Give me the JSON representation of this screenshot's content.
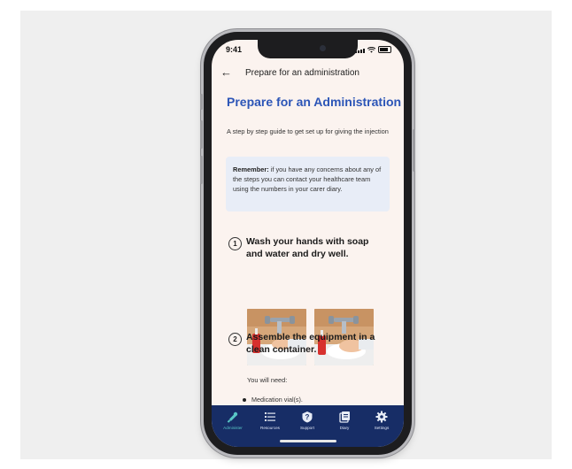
{
  "status_bar": {
    "time": "9:41"
  },
  "nav": {
    "back_icon": "arrow-left-icon",
    "title": "Prepare for an administration"
  },
  "page": {
    "heading": "Prepare for an Administration",
    "intro": "A step by step guide to get set up for giving the injection",
    "callout_bold": "Remember:",
    "callout_text": " if you have any concerns about any of the steps you can contact your healthcare team using the numbers in your carer diary."
  },
  "steps": [
    {
      "number": "1",
      "title": "Wash your hands with soap and water and dry well."
    },
    {
      "number": "2",
      "title": "Assemble the equipment in a clean container."
    }
  ],
  "step2": {
    "you_will_need": "You will need:",
    "items": [
      "Medication vial(s)."
    ]
  },
  "tabs": [
    {
      "label": "Administer",
      "icon": "syringe-icon",
      "active": true
    },
    {
      "label": "Resources",
      "icon": "list-icon",
      "active": false
    },
    {
      "label": "Support",
      "icon": "help-icon",
      "active": false
    },
    {
      "label": "Diary",
      "icon": "diary-icon",
      "active": false
    },
    {
      "label": "Settings",
      "icon": "gear-icon",
      "active": false
    }
  ],
  "colors": {
    "accent": "#2c55b7",
    "tabbar": "#172d66",
    "active_tab": "#59c7c6",
    "callout_bg": "#e8edf7"
  }
}
